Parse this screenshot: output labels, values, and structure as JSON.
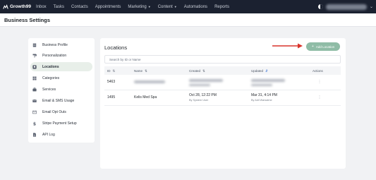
{
  "brand": {
    "name": "Growth99"
  },
  "nav": {
    "items": [
      {
        "label": "Inbox"
      },
      {
        "label": "Tasks"
      },
      {
        "label": "Contacts"
      },
      {
        "label": "Appointments"
      },
      {
        "label": "Marketing",
        "dropdown": true
      },
      {
        "label": "Content",
        "dropdown": true
      },
      {
        "label": "Automations"
      },
      {
        "label": "Reports"
      }
    ]
  },
  "page": {
    "title": "Business Settings"
  },
  "sidebar": {
    "items": [
      {
        "label": "Business Profile",
        "icon": "building-icon"
      },
      {
        "label": "Personalization",
        "icon": "paint-roller-icon"
      },
      {
        "label": "Locations",
        "icon": "location-icon",
        "active": true
      },
      {
        "label": "Categories",
        "icon": "grid-icon"
      },
      {
        "label": "Services",
        "icon": "briefcase-icon"
      },
      {
        "label": "Email & SMS Usage",
        "icon": "envelope-icon"
      },
      {
        "label": "Email Opt Outs",
        "icon": "envelope-x-icon"
      },
      {
        "label": "Stripe Payment Setup",
        "icon": "dollar-icon"
      },
      {
        "label": "API Log",
        "icon": "file-icon"
      }
    ]
  },
  "locations": {
    "title": "Locations",
    "add_button_label": "Add Location",
    "search_placeholder": "Search by ID or Name",
    "columns": {
      "id": "ID",
      "name": "Name",
      "created": "Created",
      "updated": "Updated",
      "actions": "Actions"
    },
    "rows": [
      {
        "id": "5463",
        "name": "",
        "created": "",
        "created_by": "",
        "updated": "",
        "updated_by": "",
        "redacted": true
      },
      {
        "id": "1495",
        "name": "Kelis Med Spa",
        "created": "Oct 28, 12:22 PM",
        "created_by": "By System User",
        "updated": "Mar 31, 4:14 PM",
        "updated_by": "By Adil Warsalme",
        "redacted": false
      }
    ]
  },
  "colors": {
    "nav_bg": "#1b2130",
    "accent_button": "#8fbca6",
    "active_sidebar_bg": "#e8efe9",
    "annotation_arrow": "#d9342b"
  }
}
